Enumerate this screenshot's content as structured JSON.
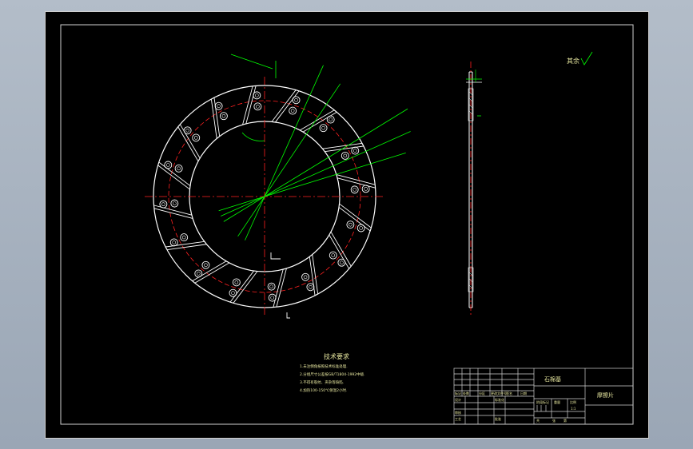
{
  "drawing": {
    "roughness_mark": "其余",
    "tech_requirements_title": "技术要求",
    "tech_requirements": [
      "1.未注倒角按照技术标准处理.",
      "2.分组尺寸公差按GB/T1804-1992中级.",
      "3.不得有裂纹、夹杂等缺陷.",
      "4.加热100-150℃保温2小时."
    ],
    "title_block": {
      "material": "石棉基",
      "part_name": "摩擦片",
      "labels": {
        "mark": "标记",
        "count": "处数",
        "zone": "分区",
        "change_doc": "更改文件号",
        "signature": "签名",
        "date": "日期",
        "designer": "设计",
        "standardization": "标准化",
        "review": "审核",
        "process": "工艺",
        "approve": "批准",
        "stage_mark": "阶段标记",
        "weight": "重量",
        "scale": "比例",
        "scale_value": "1:1",
        "sheets_total": "共",
        "sheets_unit": "张",
        "sheet_no": "第"
      }
    }
  },
  "colors": {
    "outline": "#ffffff",
    "centerline": "#ff2020",
    "dimension": "#00ff00",
    "text": "#e8e8a0",
    "frame": "#d0d0d0"
  }
}
